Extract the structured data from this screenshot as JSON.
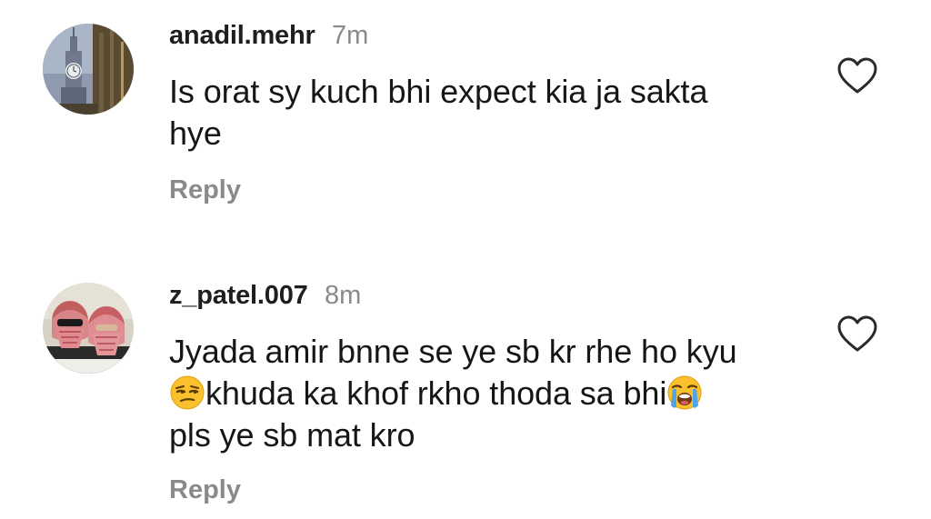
{
  "comments": [
    {
      "username": "anadil.mehr",
      "time": "7m",
      "text_lines": [
        "Is orat sy kuch bhi expect kia ja sakta",
        "hye"
      ],
      "reply_label": "Reply",
      "avatar_icon": "clock-tower-avatar",
      "like_icon": "heart-outline-icon"
    },
    {
      "username": "z_patel.007",
      "time": "8m",
      "text_line1": "Jyada amir bnne se ye sb kr rhe ho kyu",
      "text_line2": "khuda ka khof rkho thoda sa bhi",
      "text_line3": "pls ye sb mat kro",
      "emoji_1": "unamused-face-emoji",
      "emoji_2": "loudly-crying-face-emoji",
      "reply_label": "Reply",
      "avatar_icon": "two-people-avatar",
      "like_icon": "heart-outline-icon"
    }
  ],
  "colors": {
    "username": "#1e1e1e",
    "secondary_text": "#8a8a8a",
    "body_text": "#161616",
    "icon_stroke": "#2a2a2a"
  }
}
